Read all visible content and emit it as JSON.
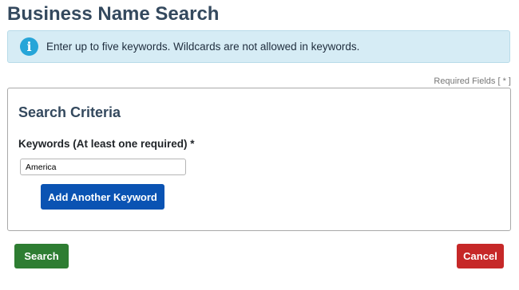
{
  "page": {
    "title": "Business Name Search"
  },
  "alert": {
    "icon": "info-icon",
    "icon_glyph": "i",
    "message": "Enter up to five keywords. Wildcards are not allowed in keywords.",
    "background_color": "#d6ecf5",
    "icon_color": "#26a5d8"
  },
  "required_note": "Required Fields [ * ]",
  "criteria": {
    "title": "Search Criteria",
    "keywords_label": "Keywords (At least one required) *",
    "keyword_value": "America",
    "add_keyword_label": "Add Another Keyword"
  },
  "actions": {
    "search_label": "Search",
    "cancel_label": "Cancel"
  },
  "colors": {
    "title": "#34495e",
    "primary_button": "#0a53b3",
    "search_button": "#2e7d32",
    "cancel_button": "#c62828"
  }
}
